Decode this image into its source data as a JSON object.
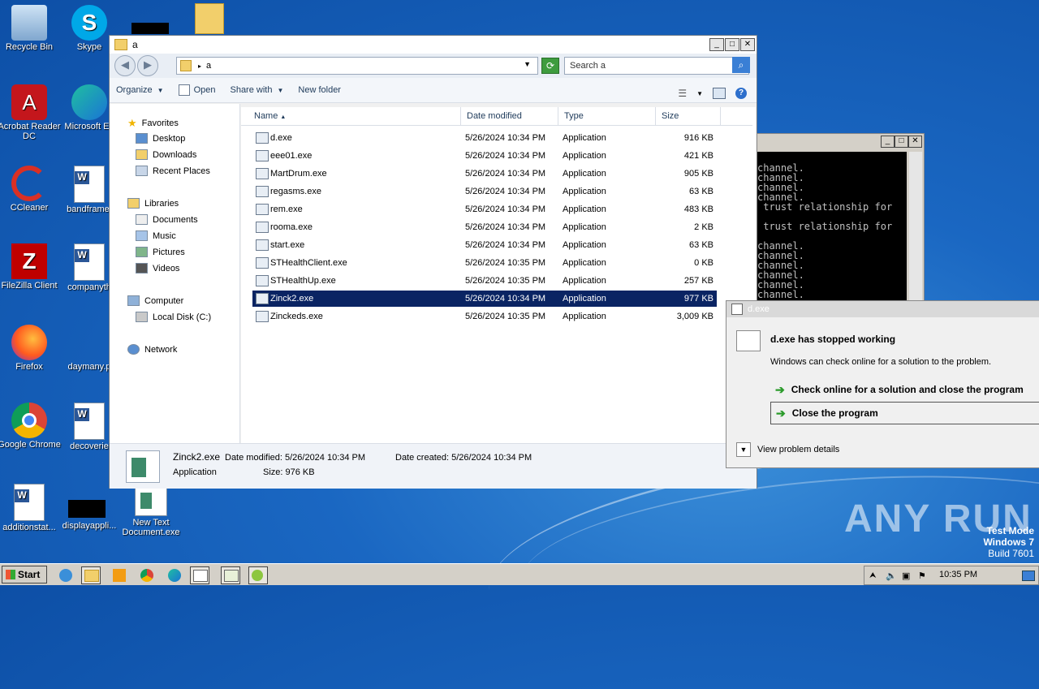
{
  "desktop": {
    "icons": [
      {
        "label": "Recycle Bin"
      },
      {
        "label": "Skype"
      },
      {
        "label": "Acrobat Reader DC"
      },
      {
        "label": "Microsoft Ed"
      },
      {
        "label": "CCleaner"
      },
      {
        "label": "bandframe."
      },
      {
        "label": "FileZilla Client"
      },
      {
        "label": "companyth"
      },
      {
        "label": "Firefox"
      },
      {
        "label": "daymany.p"
      },
      {
        "label": "Google Chrome"
      },
      {
        "label": "decoverie"
      },
      {
        "label": "additionstat..."
      },
      {
        "label": "displayappli..."
      },
      {
        "label": "New Text Document.exe"
      }
    ]
  },
  "explorer": {
    "title": "a",
    "address": "a",
    "search_placeholder": "Search a",
    "toolbar": {
      "organize": "Organize",
      "open": "Open",
      "share_with": "Share with",
      "new_folder": "New folder"
    },
    "nav": {
      "favorites": "Favorites",
      "desktop": "Desktop",
      "downloads": "Downloads",
      "recent": "Recent Places",
      "libraries": "Libraries",
      "documents": "Documents",
      "music": "Music",
      "pictures": "Pictures",
      "videos": "Videos",
      "computer": "Computer",
      "local_disk": "Local Disk (C:)",
      "network": "Network"
    },
    "columns": {
      "name": "Name",
      "date": "Date modified",
      "type": "Type",
      "size": "Size"
    },
    "files": [
      {
        "name": "d.exe",
        "date": "5/26/2024 10:34 PM",
        "type": "Application",
        "size": "916 KB"
      },
      {
        "name": "eee01.exe",
        "date": "5/26/2024 10:34 PM",
        "type": "Application",
        "size": "421 KB"
      },
      {
        "name": "MartDrum.exe",
        "date": "5/26/2024 10:34 PM",
        "type": "Application",
        "size": "905 KB"
      },
      {
        "name": "regasms.exe",
        "date": "5/26/2024 10:34 PM",
        "type": "Application",
        "size": "63 KB"
      },
      {
        "name": "rem.exe",
        "date": "5/26/2024 10:34 PM",
        "type": "Application",
        "size": "483 KB"
      },
      {
        "name": "rooma.exe",
        "date": "5/26/2024 10:34 PM",
        "type": "Application",
        "size": "2 KB"
      },
      {
        "name": "start.exe",
        "date": "5/26/2024 10:34 PM",
        "type": "Application",
        "size": "63 KB"
      },
      {
        "name": "STHealthClient.exe",
        "date": "5/26/2024 10:35 PM",
        "type": "Application",
        "size": "0 KB"
      },
      {
        "name": "STHealthUp.exe",
        "date": "5/26/2024 10:35 PM",
        "type": "Application",
        "size": "257 KB"
      },
      {
        "name": "Zinck2.exe",
        "date": "5/26/2024 10:34 PM",
        "type": "Application",
        "size": "977 KB"
      },
      {
        "name": "Zinckeds.exe",
        "date": "5/26/2024 10:35 PM",
        "type": "Application",
        "size": "3,009 KB"
      }
    ],
    "selected_index": 9,
    "details": {
      "name": "Zinck2.exe",
      "date_modified": "Date modified: 5/26/2024 10:34 PM",
      "date_created": "Date created: 5/26/2024 10:34 PM",
      "type": "Application",
      "size": "Size: 976 KB"
    }
  },
  "console": {
    "lines": "channel.\nchannel.\nchannel.\nchannel.\n trust relationship for\n\n trust relationship for\n\nchannel.\nchannel.\nchannel.\nchannel.\nchannel.\nchannel."
  },
  "error_dialog": {
    "title": "d.exe",
    "heading": "d.exe has stopped working",
    "message": "Windows can check online for a solution to the problem.",
    "option1": "Check online for a solution and close the program",
    "option2": "Close the program",
    "details": "View problem details"
  },
  "watermark": {
    "text": "ANY RUN",
    "line1": "Test Mode",
    "line2": "Windows 7",
    "line3": "Build 7601"
  },
  "taskbar": {
    "start": "Start",
    "clock": "10:35 PM"
  }
}
